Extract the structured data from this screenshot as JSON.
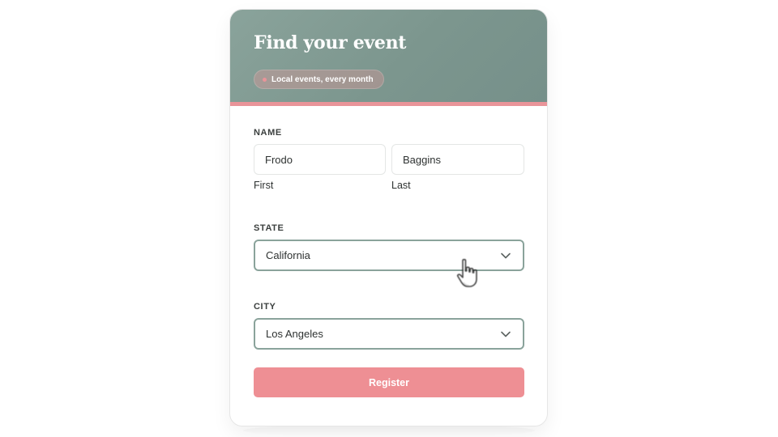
{
  "header": {
    "title": "Find your event",
    "badge": "Local events, every month"
  },
  "form": {
    "name_section": {
      "label": "NAME",
      "first": {
        "value": "Frodo",
        "caption": "First"
      },
      "last": {
        "value": "Baggins",
        "caption": "Last"
      }
    },
    "state_section": {
      "label": "STATE",
      "selected": "California",
      "icon": "chevron-down-icon"
    },
    "city_section": {
      "label": "CITY",
      "selected": "Los Angeles",
      "icon": "chevron-down-icon"
    },
    "submit_label": "Register"
  },
  "colors": {
    "header_bg": "#7c968e",
    "accent": "#e99499",
    "button": "#ee8f94",
    "focus_border": "#8aa39b"
  },
  "cursor": {
    "icon": "hand-pointer-icon"
  }
}
